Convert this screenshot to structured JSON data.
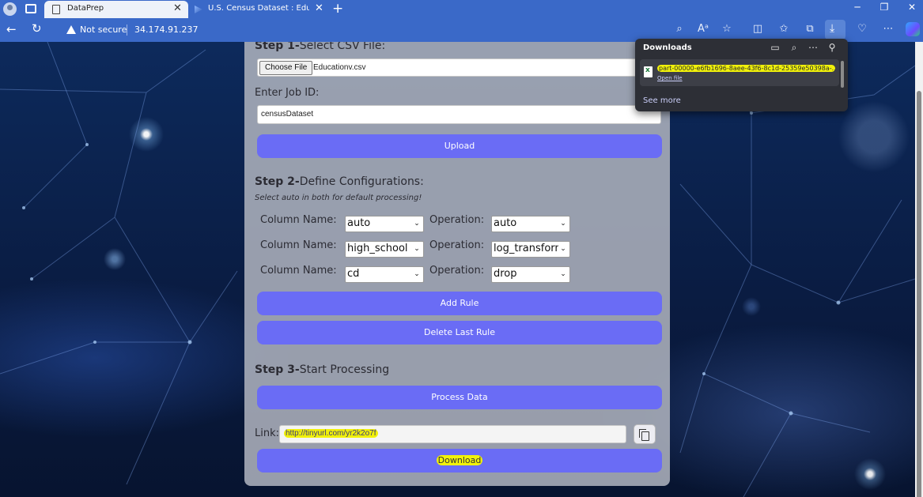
{
  "browser": {
    "tabs": [
      {
        "title": "DataPrep",
        "active": true
      },
      {
        "title": "U.S. Census Dataset : Education, ",
        "active": false
      }
    ],
    "security_label": "Not secure",
    "url": "34.174.91.237"
  },
  "downloads": {
    "title": "Downloads",
    "item_name": "part-00000-e6fb1696-8aee-43f6-8c1d-25359e50398a-...",
    "item_action": "Open file",
    "see_more": "See more"
  },
  "step1": {
    "prefix": "Step 1-",
    "title": "Select CSV File:",
    "choose_button": "Choose File",
    "file_name": "Educationv.csv",
    "job_label": "Enter Job ID:",
    "job_value": "censusDataset",
    "upload_button": "Upload"
  },
  "step2": {
    "prefix": "Step 2-",
    "title": "Define Configurations:",
    "note": "Select auto in both for default processing!",
    "column_label": "Column Name:",
    "operation_label": "Operation:",
    "rules": [
      {
        "column": "auto",
        "operation": "auto"
      },
      {
        "column": "high_school",
        "operation": "log_transform"
      },
      {
        "column": "cd",
        "operation": "drop"
      }
    ],
    "add_button": "Add Rule",
    "delete_button": "Delete Last Rule"
  },
  "step3": {
    "prefix": "Step 3-",
    "title": "Start Processing",
    "process_button": "Process Data",
    "link_label": "Link:",
    "link_value": "http://tinyurl.com/yr2k2o7f",
    "download_button": "Download"
  },
  "colors": {
    "accent": "#6a6cf5",
    "highlight": "#f1f10a",
    "chrome": "#3a69c8"
  }
}
